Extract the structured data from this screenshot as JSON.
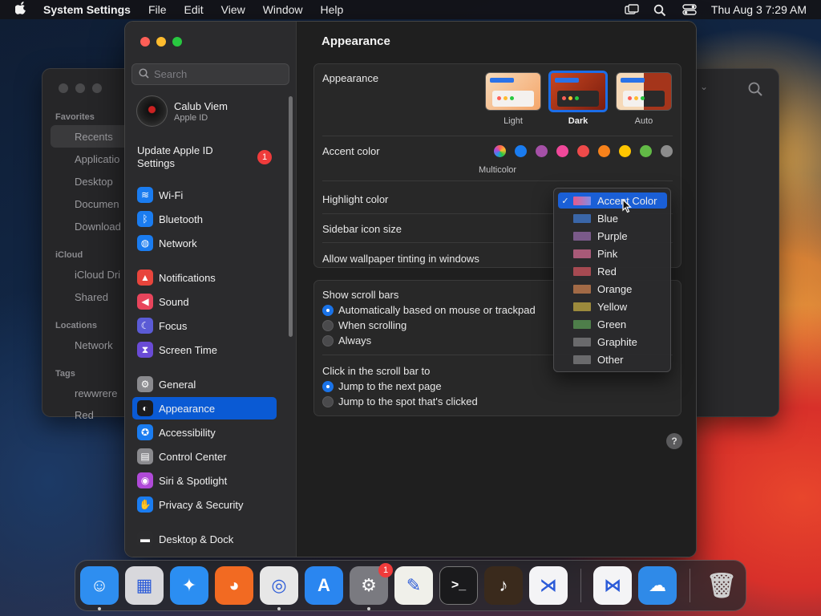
{
  "menubar": {
    "app_name": "System Settings",
    "menus": [
      "File",
      "Edit",
      "View",
      "Window",
      "Help"
    ],
    "datetime": "Thu Aug 3  7:29 AM"
  },
  "finder": {
    "favorites_title": "Favorites",
    "favorites": [
      "Recents",
      "Applicatio",
      "Desktop",
      "Documen",
      "Download"
    ],
    "icloud_title": "iCloud",
    "icloud": [
      "iCloud Dri",
      "Shared"
    ],
    "locations_title": "Locations",
    "locations": [
      "Network"
    ],
    "tags_title": "Tags",
    "tags": [
      "rewwrere",
      "Red"
    ]
  },
  "sidebar": {
    "search_placeholder": "Search",
    "profile_name": "Calub Viem",
    "profile_sub": "Apple ID",
    "update_label": "Update Apple ID Settings",
    "update_badge": "1",
    "items": [
      {
        "label": "Wi-Fi",
        "icon": "wifi-icon",
        "color": "#1a7cf0",
        "glyph": "≋"
      },
      {
        "label": "Bluetooth",
        "icon": "bluetooth-icon",
        "color": "#1a7cf0",
        "glyph": "ᛒ"
      },
      {
        "label": "Network",
        "icon": "globe-icon",
        "color": "#1a7cf0",
        "glyph": "◍"
      },
      {
        "label": "Notifications",
        "icon": "bell-icon",
        "color": "#e8453c",
        "glyph": "▲"
      },
      {
        "label": "Sound",
        "icon": "speaker-icon",
        "color": "#e8455c",
        "glyph": "◀"
      },
      {
        "label": "Focus",
        "icon": "moon-icon",
        "color": "#5b5bd6",
        "glyph": "☾"
      },
      {
        "label": "Screen Time",
        "icon": "hourglass-icon",
        "color": "#6a4bd6",
        "glyph": "⧗"
      },
      {
        "label": "General",
        "icon": "gear-icon",
        "color": "#8a8a8e",
        "glyph": "⚙"
      },
      {
        "label": "Appearance",
        "icon": "appearance-icon",
        "color": "#1c1c1e",
        "glyph": "◐"
      },
      {
        "label": "Accessibility",
        "icon": "accessibility-icon",
        "color": "#1a7cf0",
        "glyph": "✪"
      },
      {
        "label": "Control Center",
        "icon": "control-center-icon",
        "color": "#8a8a8e",
        "glyph": "▤"
      },
      {
        "label": "Siri & Spotlight",
        "icon": "siri-icon",
        "color": "#b04ad8",
        "glyph": "◉"
      },
      {
        "label": "Privacy & Security",
        "icon": "hand-icon",
        "color": "#1a7cf0",
        "glyph": "✋"
      },
      {
        "label": "Desktop & Dock",
        "icon": "dock-icon",
        "color": "#2c2c2e",
        "glyph": "▬"
      }
    ],
    "selected": "Appearance"
  },
  "main": {
    "title": "Appearance",
    "appearance_label": "Appearance",
    "appearance_options": [
      "Light",
      "Dark",
      "Auto"
    ],
    "appearance_selected": "Dark",
    "accent_label": "Accent color",
    "accent_caption": "Multicolor",
    "accent_colors": [
      "#1a7cf0",
      "#a550a7",
      "#f0489a",
      "#ee4a4a",
      "#f7821b",
      "#ffc600",
      "#62ba46",
      "#8c8c8c"
    ],
    "highlight_label": "Highlight color",
    "sidebar_icon_label": "Sidebar icon size",
    "wallpaper_tint_label": "Allow wallpaper tinting in windows",
    "scrollbars_title": "Show scroll bars",
    "scrollbars_options": [
      "Automatically based on mouse or trackpad",
      "When scrolling",
      "Always"
    ],
    "scrollbars_selected": 0,
    "click_title": "Click in the scroll bar to",
    "click_options": [
      "Jump to the next page",
      "Jump to the spot that's clicked"
    ],
    "click_selected": 0,
    "help": "?"
  },
  "highlight_menu": {
    "options": [
      {
        "label": "Accent Color",
        "color": "#b7729a",
        "checked": true
      },
      {
        "label": "Blue",
        "color": "#3a66a8"
      },
      {
        "label": "Purple",
        "color": "#7a5a8a"
      },
      {
        "label": "Pink",
        "color": "#a85a78"
      },
      {
        "label": "Red",
        "color": "#a64a52"
      },
      {
        "label": "Orange",
        "color": "#a26a46"
      },
      {
        "label": "Yellow",
        "color": "#9c8a3c"
      },
      {
        "label": "Green",
        "color": "#4e7e4a"
      },
      {
        "label": "Graphite",
        "color": "#6a6a6c"
      },
      {
        "label": "Other",
        "color": "#6a6a6c"
      }
    ],
    "check_glyph": "✓"
  },
  "dock": {
    "apps": [
      {
        "name": "Finder",
        "icon": "finder-icon",
        "color": "#2e8ef0",
        "glyph": "☺",
        "running": true
      },
      {
        "name": "Launchpad",
        "icon": "launchpad-icon",
        "color": "#d8d8dc",
        "glyph": "▦",
        "running": false
      },
      {
        "name": "Safari",
        "icon": "safari-icon",
        "color": "#2b8ef2",
        "glyph": "✦",
        "running": false
      },
      {
        "name": "Firefox",
        "icon": "firefox-icon",
        "color": "#f26a22",
        "glyph": "◕",
        "running": false
      },
      {
        "name": "Chrome",
        "icon": "chrome-icon",
        "color": "#e7e7e7",
        "glyph": "◎",
        "running": true
      },
      {
        "name": "App Store",
        "icon": "app-store-icon",
        "color": "#2a86f0",
        "glyph": "A",
        "running": false
      },
      {
        "name": "System Settings",
        "icon": "settings-icon",
        "color": "#7a7a80",
        "glyph": "⚙",
        "running": true,
        "badge": "1"
      },
      {
        "name": "TextEdit",
        "icon": "textedit-icon",
        "color": "#f0f0ea",
        "glyph": "✎",
        "running": false
      },
      {
        "name": "Terminal",
        "icon": "terminal-icon",
        "color": "#1a1a1c",
        "glyph": ">_",
        "running": false
      },
      {
        "name": "GarageBand",
        "icon": "guitar-icon",
        "color": "#3a2a1c",
        "glyph": "♪",
        "running": false
      },
      {
        "name": "VS Code",
        "icon": "vscode-icon",
        "color": "#f4f4f6",
        "glyph": "⋊",
        "running": false
      },
      {
        "name": "Visual Studio",
        "icon": "visual-studio-icon",
        "color": "#f4f4f6",
        "glyph": "⋈",
        "running": false
      },
      {
        "name": "Weather",
        "icon": "weather-icon",
        "color": "#2f8ae8",
        "glyph": "☁",
        "running": false
      },
      {
        "name": "Trash",
        "icon": "trash-icon",
        "color": "transparent",
        "glyph": "🗑",
        "running": false
      }
    ]
  }
}
